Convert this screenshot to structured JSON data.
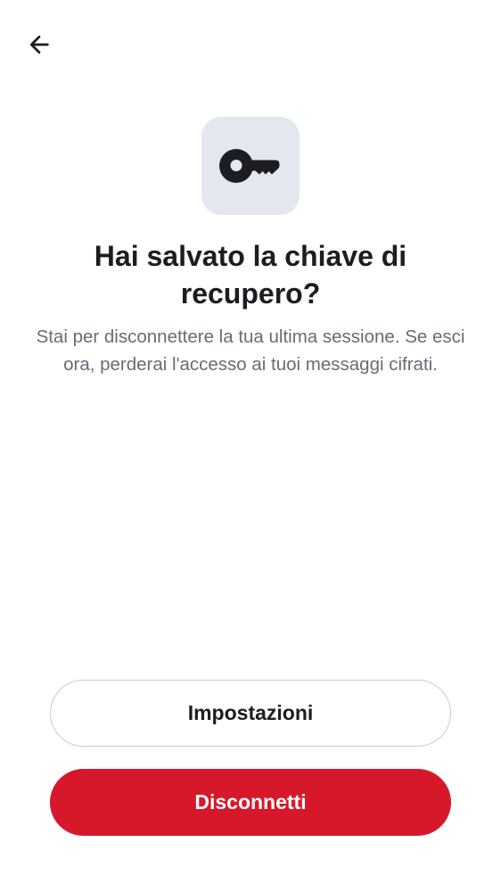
{
  "header": {
    "back_icon": "arrow-left-icon"
  },
  "hero": {
    "icon": "key-icon",
    "title": "Hai salvato la chiave di recupero?",
    "description": "Stai per disconnettere la tua ultima sessione. Se esci ora, perderai l'accesso ai tuoi messaggi cifrati."
  },
  "actions": {
    "settings_label": "Impostazioni",
    "signout_label": "Disconnetti"
  },
  "colors": {
    "primary": "#d7182a",
    "icon_tile": "#e3e7f0",
    "text": "#1b1d22",
    "secondary_text": "#656d77"
  }
}
